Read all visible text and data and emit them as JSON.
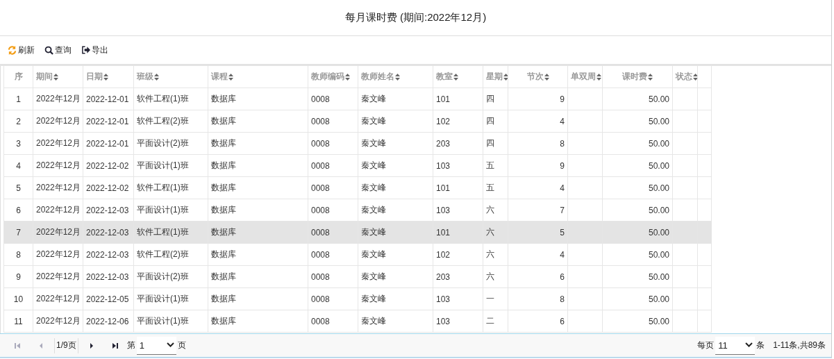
{
  "title": "每月课时费 (期间:2022年12月)",
  "toolbar": [
    {
      "kind": "refresh",
      "label": "刷新"
    },
    {
      "kind": "search",
      "label": "查询"
    },
    {
      "kind": "export",
      "label": "导出"
    }
  ],
  "table": {
    "columns": [
      {
        "label": "序",
        "sortable": false
      },
      {
        "label": "期间",
        "sortable": true
      },
      {
        "label": "日期",
        "sortable": true
      },
      {
        "label": "班级",
        "sortable": true
      },
      {
        "label": "课程",
        "sortable": true
      },
      {
        "label": "教师编码",
        "sortable": true
      },
      {
        "label": "教师姓名",
        "sortable": true
      },
      {
        "label": "教室",
        "sortable": true
      },
      {
        "label": "星期",
        "sortable": true
      },
      {
        "label": "节次",
        "sortable": true
      },
      {
        "label": "单双周",
        "sortable": true
      },
      {
        "label": "课时费",
        "sortable": true
      },
      {
        "label": "状态",
        "sortable": true
      }
    ],
    "rows": [
      {
        "selected": false,
        "cells": [
          "1",
          "2022年12月",
          "2022-12-01",
          "软件工程(1)班",
          "数据库",
          "0008",
          "秦文峰",
          "101",
          "四",
          "9",
          "",
          "50.00",
          ""
        ]
      },
      {
        "selected": false,
        "cells": [
          "2",
          "2022年12月",
          "2022-12-01",
          "软件工程(2)班",
          "数据库",
          "0008",
          "秦文峰",
          "102",
          "四",
          "4",
          "",
          "50.00",
          ""
        ]
      },
      {
        "selected": false,
        "cells": [
          "3",
          "2022年12月",
          "2022-12-01",
          "平面设计(2)班",
          "数据库",
          "0008",
          "秦文峰",
          "203",
          "四",
          "8",
          "",
          "50.00",
          ""
        ]
      },
      {
        "selected": false,
        "cells": [
          "4",
          "2022年12月",
          "2022-12-02",
          "平面设计(1)班",
          "数据库",
          "0008",
          "秦文峰",
          "103",
          "五",
          "9",
          "",
          "50.00",
          ""
        ]
      },
      {
        "selected": false,
        "cells": [
          "5",
          "2022年12月",
          "2022-12-02",
          "软件工程(1)班",
          "数据库",
          "0008",
          "秦文峰",
          "101",
          "五",
          "4",
          "",
          "50.00",
          ""
        ]
      },
      {
        "selected": false,
        "cells": [
          "6",
          "2022年12月",
          "2022-12-03",
          "平面设计(1)班",
          "数据库",
          "0008",
          "秦文峰",
          "103",
          "六",
          "7",
          "",
          "50.00",
          ""
        ]
      },
      {
        "selected": true,
        "cells": [
          "7",
          "2022年12月",
          "2022-12-03",
          "软件工程(1)班",
          "数据库",
          "0008",
          "秦文峰",
          "101",
          "六",
          "5",
          "",
          "50.00",
          ""
        ]
      },
      {
        "selected": false,
        "cells": [
          "8",
          "2022年12月",
          "2022-12-03",
          "软件工程(2)班",
          "数据库",
          "0008",
          "秦文峰",
          "102",
          "六",
          "4",
          "",
          "50.00",
          ""
        ]
      },
      {
        "selected": false,
        "cells": [
          "9",
          "2022年12月",
          "2022-12-03",
          "平面设计(2)班",
          "数据库",
          "0008",
          "秦文峰",
          "203",
          "六",
          "6",
          "",
          "50.00",
          ""
        ]
      },
      {
        "selected": false,
        "cells": [
          "10",
          "2022年12月",
          "2022-12-05",
          "平面设计(1)班",
          "数据库",
          "0008",
          "秦文峰",
          "103",
          "一",
          "8",
          "",
          "50.00",
          ""
        ]
      },
      {
        "selected": false,
        "cells": [
          "11",
          "2022年12月",
          "2022-12-06",
          "平面设计(1)班",
          "数据库",
          "0008",
          "秦文峰",
          "103",
          "二",
          "6",
          "",
          "50.00",
          ""
        ]
      }
    ]
  },
  "pagination": {
    "page_info": "1/9页",
    "page_prefix": "第",
    "page_value": "1",
    "page_suffix": "页",
    "size_prefix": "每页",
    "size_value": "11",
    "size_suffix": "条",
    "summary": "1-11条,共89条"
  }
}
